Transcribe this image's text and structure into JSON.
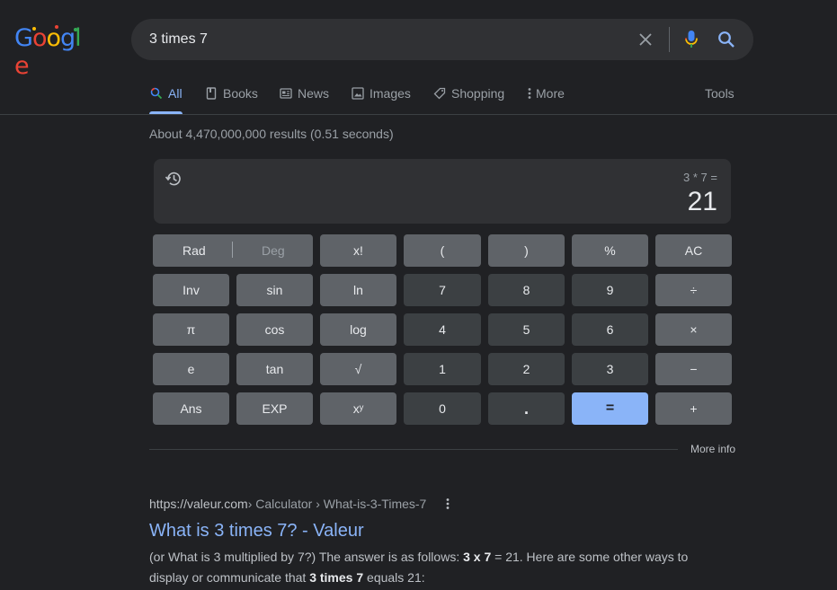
{
  "logo": {
    "letters": [
      "G",
      "o",
      "o",
      "g",
      "l",
      "e"
    ],
    "colors": [
      "#4285f4",
      "#ea4335",
      "#fbbc05",
      "#4285f4",
      "#34a853",
      "#ea4335"
    ]
  },
  "search": {
    "query": "3 times 7",
    "placeholder": ""
  },
  "tabs": [
    {
      "label": "All",
      "icon": "search-icon",
      "active": true
    },
    {
      "label": "Books",
      "icon": "book-icon"
    },
    {
      "label": "News",
      "icon": "news-icon"
    },
    {
      "label": "Images",
      "icon": "image-icon"
    },
    {
      "label": "Shopping",
      "icon": "tag-icon"
    },
    {
      "label": "More",
      "icon": "more-vert-icon"
    },
    {
      "label": "Tools"
    }
  ],
  "result_stats": "About 4,470,000,000 results (0.51 seconds)",
  "calculator": {
    "expression": "3 * 7 =",
    "result": "21",
    "rad_label": "Rad",
    "deg_label": "Deg",
    "keys": [
      [
        "x!",
        "(",
        ")",
        "%",
        "AC"
      ],
      [
        "Inv",
        "sin",
        "ln",
        "7",
        "8",
        "9",
        "÷"
      ],
      [
        "π",
        "cos",
        "log",
        "4",
        "5",
        "6",
        "×"
      ],
      [
        "e",
        "tan",
        "√",
        "1",
        "2",
        "3",
        "−"
      ],
      [
        "Ans",
        "EXP",
        "xʸ",
        "0",
        ".",
        "=",
        "+"
      ]
    ]
  },
  "more_info": "More info",
  "result": {
    "site": "https://valeur.com",
    "crumbs": " › Calculator › What-is-3-Times-7",
    "title": "What is 3 times 7? - Valeur",
    "snippet_parts": [
      "(or What is 3 multiplied by 7?) The answer is as follows: ",
      "3 x 7",
      " = 21. Here are some other ways to display or communicate that ",
      "3 times 7",
      " equals 21:"
    ]
  },
  "colors": {
    "accent": "#8ab4f8",
    "background": "#202124",
    "surface": "#303134"
  }
}
